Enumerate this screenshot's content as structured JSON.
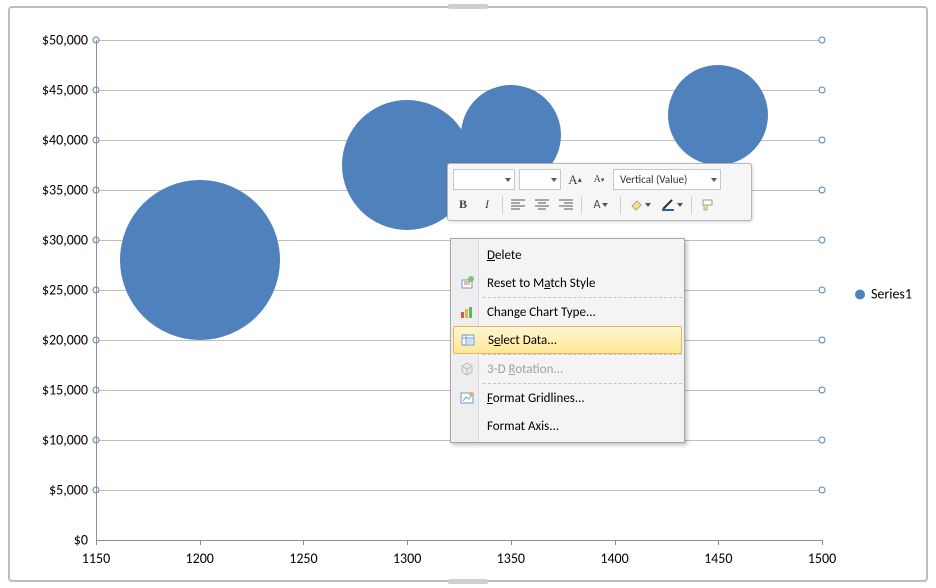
{
  "chart_data": {
    "type": "bubble",
    "x": [
      1200,
      1300,
      1350,
      1450
    ],
    "y": [
      28000,
      37500,
      40500,
      42500
    ],
    "sizes": [
      80,
      65,
      50,
      50
    ],
    "xlim": [
      1150,
      1500
    ],
    "ylim": [
      0,
      50000
    ],
    "xticks": [
      1150,
      1200,
      1250,
      1300,
      1350,
      1400,
      1450,
      1500
    ],
    "yticks": [
      0,
      5000,
      10000,
      15000,
      20000,
      25000,
      30000,
      35000,
      40000,
      45000,
      50000
    ],
    "ylabels": [
      "$50,000",
      "$45,000",
      "$40,000",
      "$35,000",
      "$30,000",
      "$25,000",
      "$20,000",
      "$15,000",
      "$10,000",
      "$5,000",
      "$0"
    ],
    "xlabels": [
      "1150",
      "1200",
      "1250",
      "1300",
      "1350",
      "1400",
      "1450",
      "1500"
    ],
    "series_name": "Series1",
    "grid": "horizontal"
  },
  "toolbar": {
    "font_name": "",
    "font_size": "",
    "element_selector": "Vertical (Value)",
    "bold": "B",
    "italic": "I",
    "font_glyph": "A",
    "grow_font_icon": "A⁺",
    "shrink_font_icon": "A⁻"
  },
  "context_menu": {
    "items": [
      {
        "label": "Delete",
        "accel": "D",
        "icon": "",
        "enabled": true
      },
      {
        "label": "Reset to Match Style",
        "accel": "A",
        "icon": "reset-icon",
        "enabled": true
      },
      {
        "sep": true
      },
      {
        "label": "Change Chart Type...",
        "accel": "",
        "icon": "chart-type-icon",
        "enabled": true
      },
      {
        "label": "Select Data...",
        "accel": "e",
        "icon": "select-data-icon",
        "enabled": true,
        "hovered": true
      },
      {
        "sep": true
      },
      {
        "label": "3-D Rotation...",
        "accel": "R",
        "icon": "rotation-icon",
        "enabled": false
      },
      {
        "sep": true
      },
      {
        "label": "Format Gridlines...",
        "accel": "F",
        "icon": "format-icon",
        "enabled": true
      },
      {
        "label": "Format Axis...",
        "accel": "",
        "icon": "",
        "enabled": true
      }
    ]
  },
  "legend": {
    "label": "Series1"
  }
}
